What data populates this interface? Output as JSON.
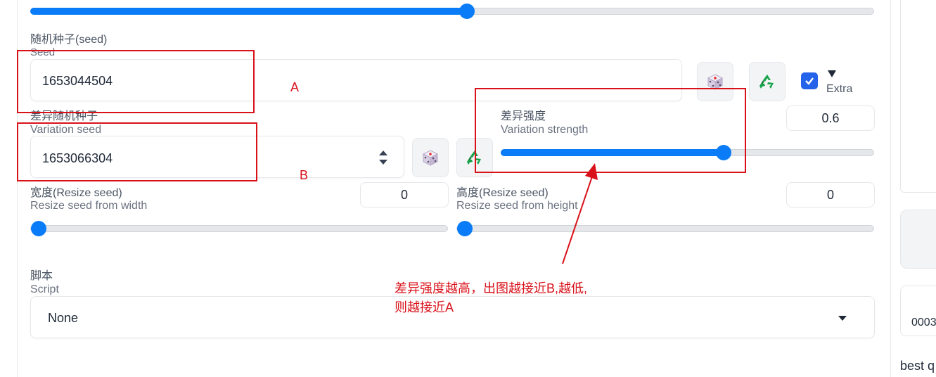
{
  "seed": {
    "label_zh": "随机种子(seed)",
    "label_en": "Seed",
    "value": "1653044504",
    "extra_label": "Extra",
    "extra_checked": true
  },
  "variation_seed": {
    "label_zh": "差异随机种子",
    "label_en": "Variation seed",
    "value": "1653066304"
  },
  "variation_strength": {
    "label_zh": "差异强度",
    "label_en": "Variation strength",
    "value": "0.6",
    "fraction": 0.6
  },
  "resize_width": {
    "label_zh": "宽度(Resize seed)",
    "label_en": "Resize seed from width",
    "value": "0",
    "fraction": 0
  },
  "resize_height": {
    "label_zh": "高度(Resize seed)",
    "label_en": "Resize seed from height",
    "value": "0",
    "fraction": 0
  },
  "top_slider": {
    "fraction": 0.5
  },
  "script": {
    "label_zh": "脚本",
    "label_en": "Script",
    "value": "None"
  },
  "annotations": {
    "a": "A",
    "b": "B",
    "note_line1": "差异强度越高，出图越接近B,越低,",
    "note_line2": "则越接近A",
    "color": "#d9121a"
  },
  "sidebar": {
    "partial_text": "0003",
    "bottom_text": "best q"
  },
  "accent_color": "#0b7cf7"
}
